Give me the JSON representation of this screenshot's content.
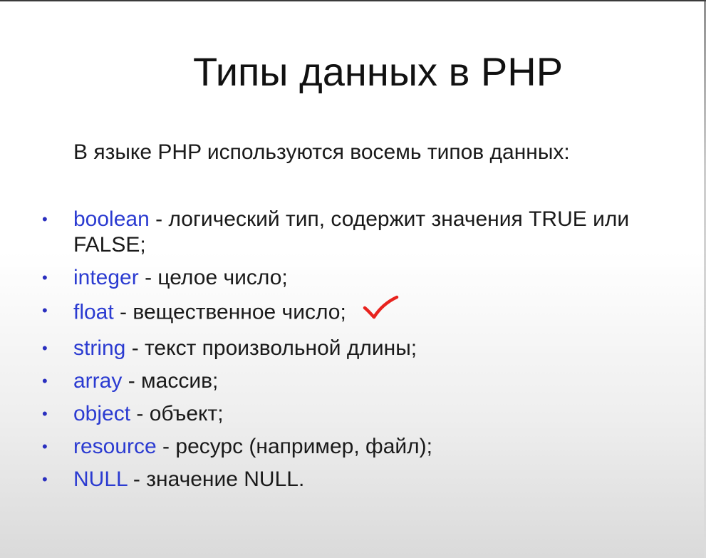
{
  "slide": {
    "title": "Типы данных в PHP",
    "subtitle": "В языке PHP используются восемь типов данных:",
    "items": [
      {
        "name": "boolean",
        "description": " - логический тип, содержит значения TRUE или FALSE;"
      },
      {
        "name": "integer",
        "description": " - целое число;"
      },
      {
        "name": "float",
        "description": " - вещественное число;"
      },
      {
        "name": "string",
        "description": " - текст произвольной длины;"
      },
      {
        "name": "array",
        "description": " - массив;"
      },
      {
        "name": "object",
        "description": " - объект;"
      },
      {
        "name": "resource",
        "description": " - ресурс (например, файл);"
      },
      {
        "name": "NULL",
        "description": " - значение NULL."
      }
    ],
    "bullet_symbol": "•",
    "check_icon": "checkmark-icon",
    "colors": {
      "type_name": "#2b3bd1",
      "text": "#1a1a1a",
      "checkmark": "#e8231e"
    }
  }
}
